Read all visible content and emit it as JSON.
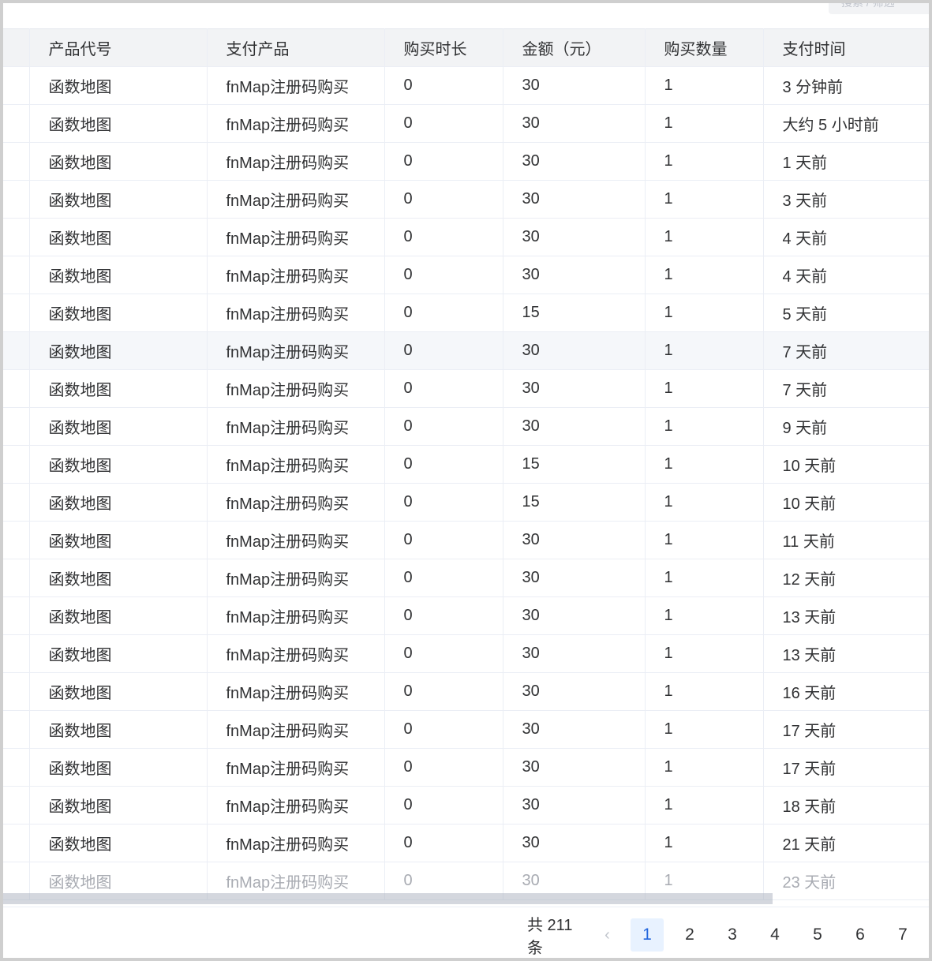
{
  "top_chip": {
    "label": "搜索 / 筛选"
  },
  "table": {
    "columns": [
      "产品代号",
      "支付产品",
      "购买时长",
      "金额（元）",
      "购买数量",
      "支付时间"
    ],
    "rows": [
      [
        "函数地图",
        "fnMap注册码购买",
        "0",
        "30",
        "1",
        "3 分钟前"
      ],
      [
        "函数地图",
        "fnMap注册码购买",
        "0",
        "30",
        "1",
        "大约 5 小时前"
      ],
      [
        "函数地图",
        "fnMap注册码购买",
        "0",
        "30",
        "1",
        "1 天前"
      ],
      [
        "函数地图",
        "fnMap注册码购买",
        "0",
        "30",
        "1",
        "3 天前"
      ],
      [
        "函数地图",
        "fnMap注册码购买",
        "0",
        "30",
        "1",
        "4 天前"
      ],
      [
        "函数地图",
        "fnMap注册码购买",
        "0",
        "30",
        "1",
        "4 天前"
      ],
      [
        "函数地图",
        "fnMap注册码购买",
        "0",
        "15",
        "1",
        "5 天前"
      ],
      [
        "函数地图",
        "fnMap注册码购买",
        "0",
        "30",
        "1",
        "7 天前"
      ],
      [
        "函数地图",
        "fnMap注册码购买",
        "0",
        "30",
        "1",
        "7 天前"
      ],
      [
        "函数地图",
        "fnMap注册码购买",
        "0",
        "30",
        "1",
        "9 天前"
      ],
      [
        "函数地图",
        "fnMap注册码购买",
        "0",
        "15",
        "1",
        "10 天前"
      ],
      [
        "函数地图",
        "fnMap注册码购买",
        "0",
        "15",
        "1",
        "10 天前"
      ],
      [
        "函数地图",
        "fnMap注册码购买",
        "0",
        "30",
        "1",
        "11 天前"
      ],
      [
        "函数地图",
        "fnMap注册码购买",
        "0",
        "30",
        "1",
        "12 天前"
      ],
      [
        "函数地图",
        "fnMap注册码购买",
        "0",
        "30",
        "1",
        "13 天前"
      ],
      [
        "函数地图",
        "fnMap注册码购买",
        "0",
        "30",
        "1",
        "13 天前"
      ],
      [
        "函数地图",
        "fnMap注册码购买",
        "0",
        "30",
        "1",
        "16 天前"
      ],
      [
        "函数地图",
        "fnMap注册码购买",
        "0",
        "30",
        "1",
        "17 天前"
      ],
      [
        "函数地图",
        "fnMap注册码购买",
        "0",
        "30",
        "1",
        "17 天前"
      ],
      [
        "函数地图",
        "fnMap注册码购买",
        "0",
        "30",
        "1",
        "18 天前"
      ],
      [
        "函数地图",
        "fnMap注册码购买",
        "0",
        "30",
        "1",
        "21 天前"
      ],
      [
        "函数地图",
        "fnMap注册码购买",
        "0",
        "30",
        "1",
        "23 天前"
      ]
    ],
    "hovered_row": 7
  },
  "pagination": {
    "total_label": "共 211 条",
    "prev_icon": "chevron-left-icon",
    "pages": [
      "1",
      "2",
      "3",
      "4",
      "5",
      "6",
      "7"
    ],
    "current_page": "1"
  },
  "colors": {
    "accent": "#2266dd",
    "active_page_bg": "#e8f2ff",
    "header_bg": "#f2f3f5",
    "border": "#ebeef5"
  }
}
